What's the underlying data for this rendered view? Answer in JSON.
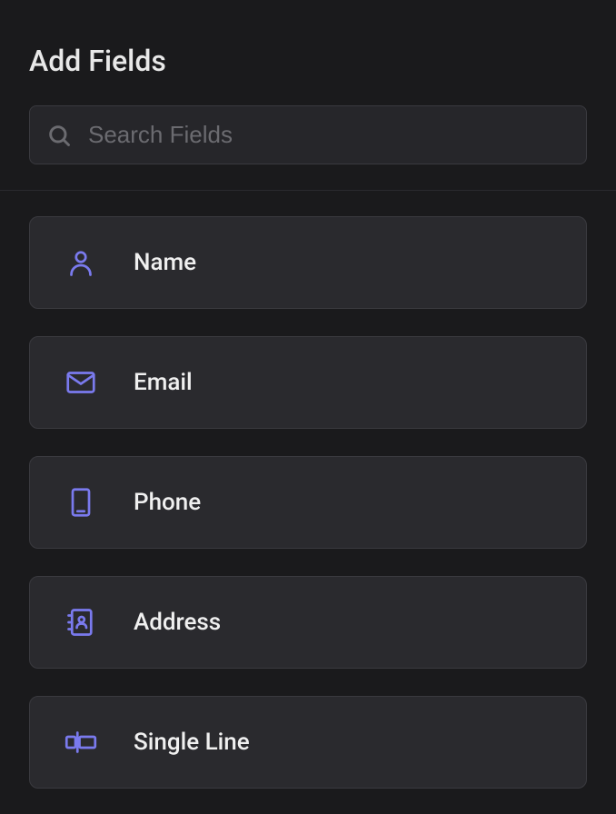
{
  "panel": {
    "title": "Add Fields"
  },
  "search": {
    "placeholder": "Search Fields"
  },
  "fields": [
    {
      "icon": "person",
      "label": "Name"
    },
    {
      "icon": "mail",
      "label": "Email"
    },
    {
      "icon": "phone",
      "label": "Phone"
    },
    {
      "icon": "address",
      "label": "Address"
    },
    {
      "icon": "single-line",
      "label": "Single Line"
    }
  ]
}
